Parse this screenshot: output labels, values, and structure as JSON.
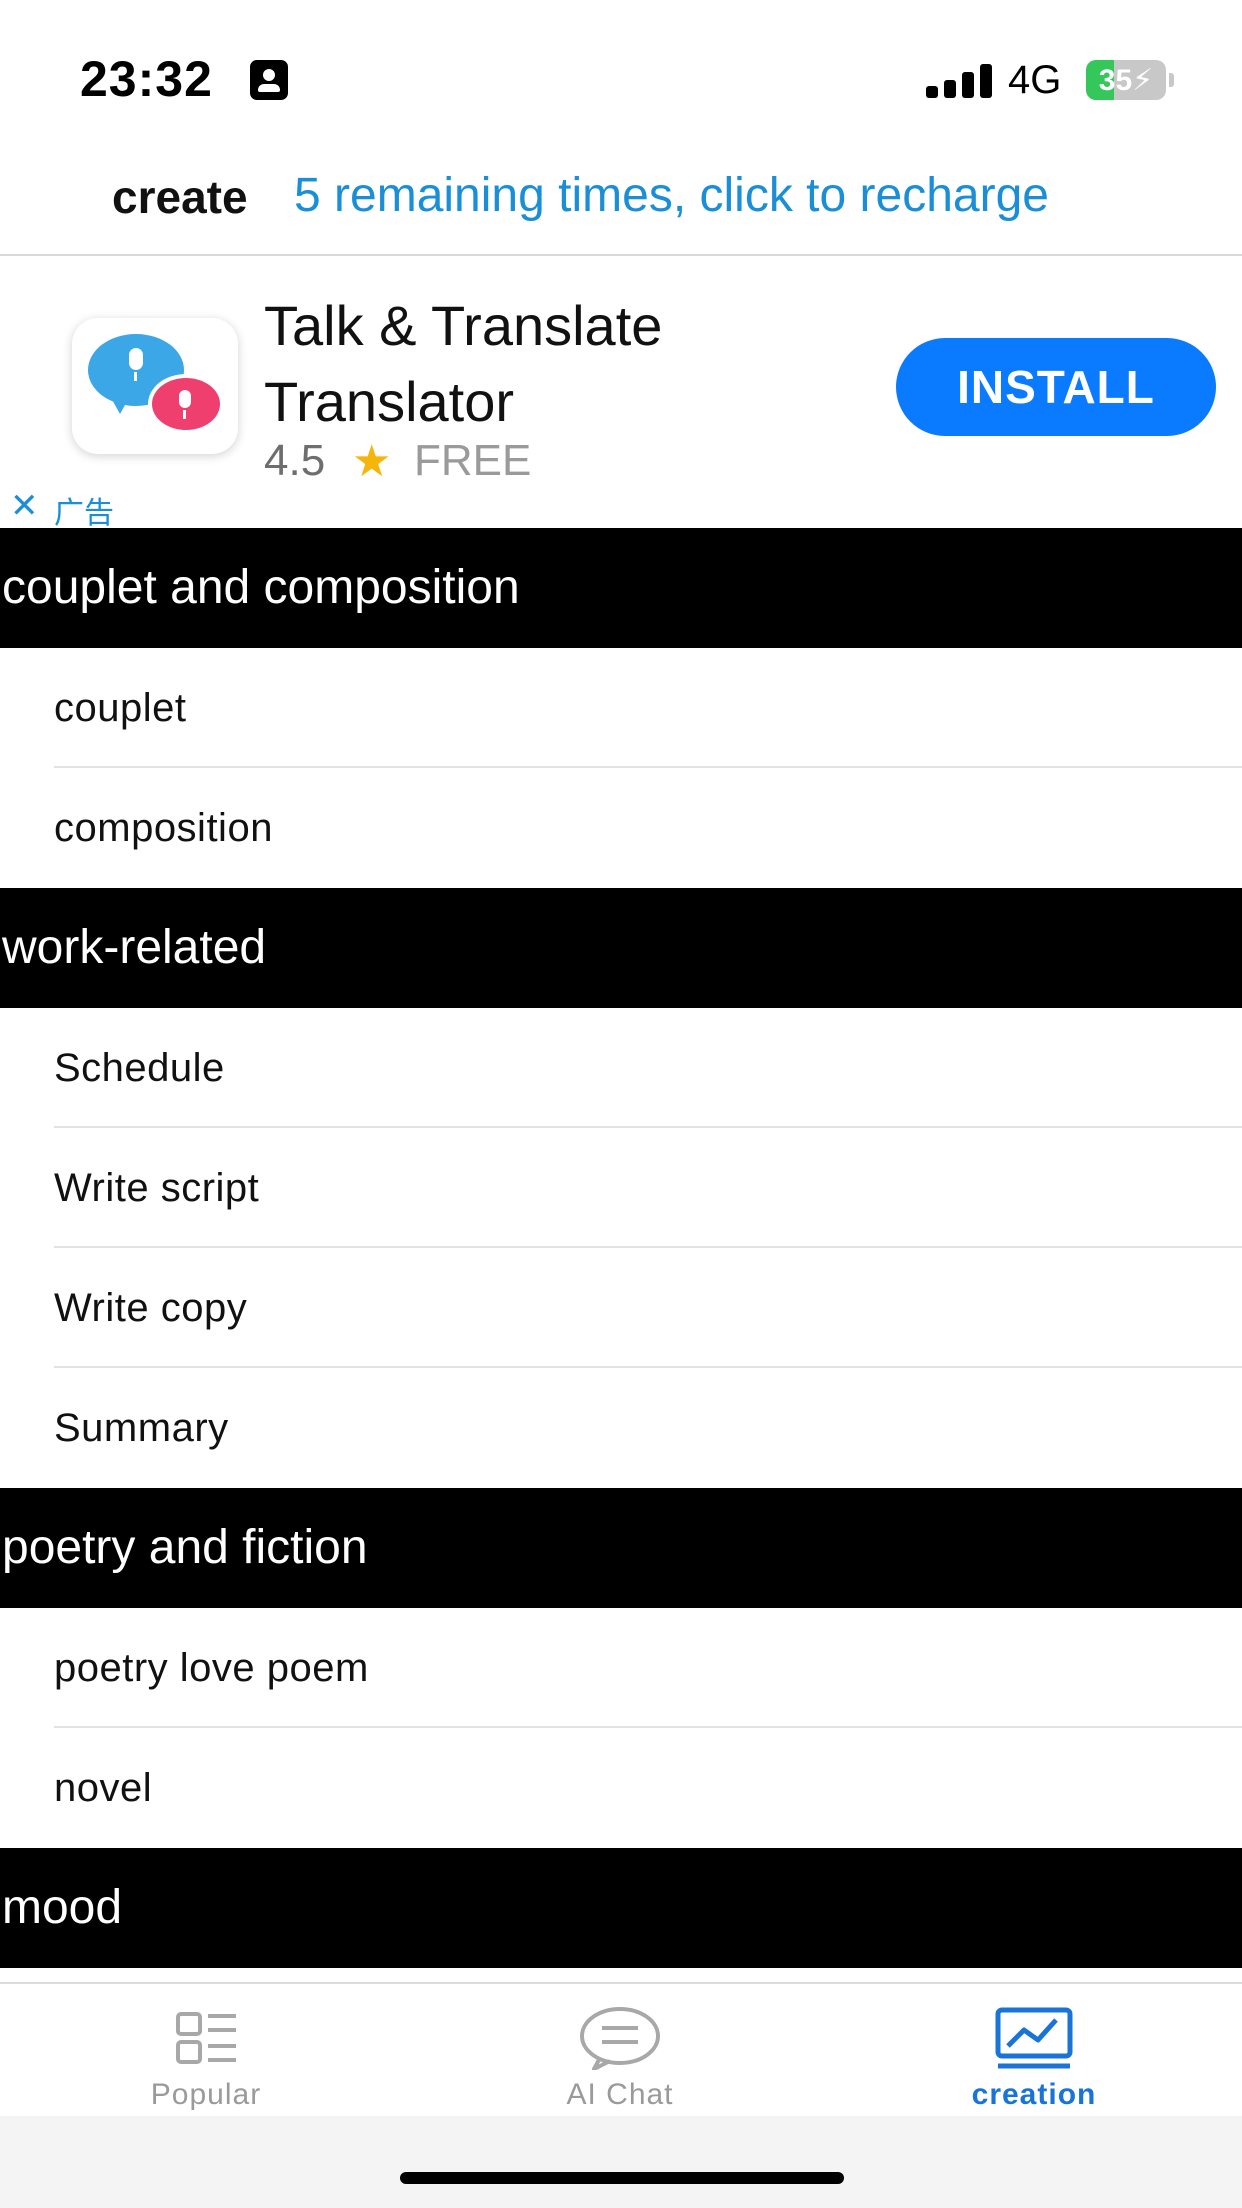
{
  "status_bar": {
    "time": "23:32",
    "network": "4G",
    "battery": "35",
    "battery_level": 0.35,
    "icons": [
      "contact-card-icon",
      "signal-icon",
      "battery-charging-icon"
    ]
  },
  "header": {
    "title": "create",
    "recharge_text": "5 remaining times, click to recharge",
    "link_color": "#1a8fd8"
  },
  "ad": {
    "title": "Talk & Translate Translator",
    "rating": "4.5",
    "star": "★",
    "price": "FREE",
    "install_label": "INSTALL",
    "close_glyph": "✕",
    "ad_label": "广告",
    "icon": "talk-translate-app-icon",
    "install_color": "#0a7aff"
  },
  "sections": [
    {
      "title": "couplet and composition",
      "items": [
        "couplet",
        "composition"
      ]
    },
    {
      "title": "work-related",
      "items": [
        "Schedule",
        "Write script",
        "Write copy",
        "Summary"
      ]
    },
    {
      "title": "poetry and fiction",
      "items": [
        "poetry love poem",
        "novel"
      ]
    },
    {
      "title": "mood",
      "items": []
    }
  ],
  "tabbar": {
    "tabs": [
      {
        "label": "Popular",
        "icon": "list-icon",
        "active": false
      },
      {
        "label": "AI Chat",
        "icon": "chat-bubble-icon",
        "active": false
      },
      {
        "label": "creation",
        "icon": "chart-icon",
        "active": true
      }
    ],
    "active_color": "#1a74d8",
    "inactive_color": "#9a9a9a"
  }
}
